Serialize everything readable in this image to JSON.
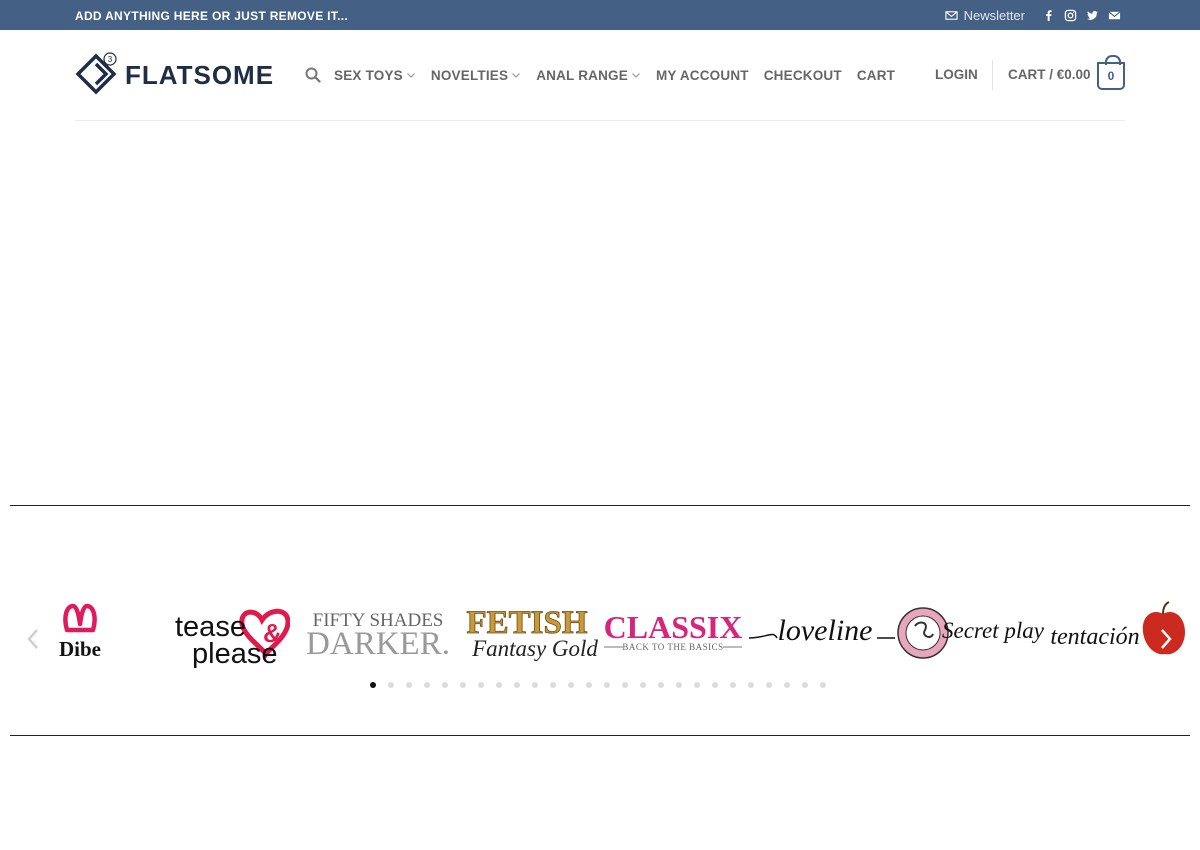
{
  "topbar": {
    "message": "ADD ANYTHING HERE OR JUST REMOVE IT...",
    "newsletter_label": "Newsletter",
    "social_icons": [
      "facebook-icon",
      "instagram-icon",
      "twitter-icon",
      "envelope-icon"
    ]
  },
  "header": {
    "logo_text": "FLATSOME",
    "nav": [
      {
        "label": "SEX TOYS",
        "has_dropdown": true
      },
      {
        "label": "NOVELTIES",
        "has_dropdown": true
      },
      {
        "label": "ANAL RANGE",
        "has_dropdown": true
      },
      {
        "label": "MY ACCOUNT",
        "has_dropdown": false
      },
      {
        "label": "CHECKOUT",
        "has_dropdown": false
      },
      {
        "label": "CART",
        "has_dropdown": false
      }
    ],
    "login_label": "LOGIN",
    "cart_label": "CART / €0.00",
    "cart_count": "0"
  },
  "brands": {
    "items": [
      {
        "name": "Dibe",
        "text": "Dibe"
      },
      {
        "name": "tease & please",
        "text_top": "tease",
        "amp": "&",
        "text_bottom": "please"
      },
      {
        "name": "Fifty Shades Darker",
        "text_top": "FIFTY SHADES",
        "text_bottom": "DARKER."
      },
      {
        "name": "Fetish Fantasy Gold",
        "text_top": "FETISH",
        "text_bottom": "Fantasy Gold"
      },
      {
        "name": "Classix",
        "text_top": "CLASSIX",
        "text_bottom": "BACK TO THE BASICS"
      },
      {
        "name": "Loveline",
        "text": "loveline"
      },
      {
        "name": "Secret play",
        "text": "Secret play"
      },
      {
        "name": "Tentación",
        "text": "tentación"
      }
    ],
    "dot_count": 26,
    "active_dot": 0
  },
  "colors": {
    "primary": "#446084",
    "logo": "#1f2e44",
    "nav_text": "#666666",
    "classix_pink": "#d6257c",
    "tease_red": "#e01b4c",
    "fetish_gold": "#b8892a"
  }
}
